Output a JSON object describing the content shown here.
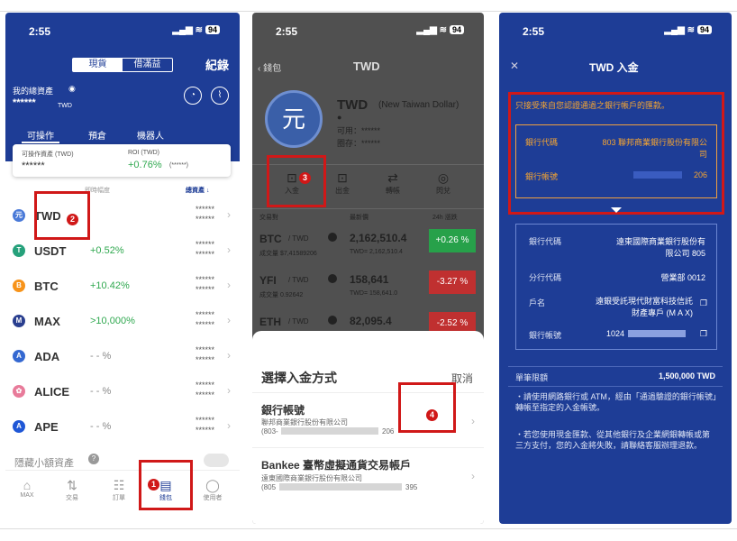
{
  "panel1": {
    "time": "2:55",
    "battery": "94",
    "seg": [
      "現貨",
      "借滿益"
    ],
    "record": "紀錄",
    "asset_label": "我的總資產",
    "asset_value": "******",
    "asset_unit": "TWD",
    "tabs": [
      "可操作",
      "預倉",
      "機器人"
    ],
    "op_label": "可操作資產 (TWD)",
    "op_value": "******",
    "roi_label": "ROI (TWD)",
    "roi_value": "+0.76%",
    "roi_sub": "(******)",
    "col_headers": [
      "",
      "即時幅度",
      "總資產 ↓"
    ],
    "coins": [
      {
        "sym": "TWD",
        "chg": "",
        "color": "#4a7ad8",
        "glyph": "元"
      },
      {
        "sym": "USDT",
        "chg": "+0.52%",
        "color": "#26a17b",
        "glyph": "T"
      },
      {
        "sym": "BTC",
        "chg": "+10.42%",
        "color": "#f7931a",
        "glyph": "B"
      },
      {
        "sym": "MAX",
        "chg": ">10,000%",
        "color": "#2a3f8f",
        "glyph": "M"
      },
      {
        "sym": "ADA",
        "chg": "- - %",
        "color": "#3468d1",
        "glyph": "A"
      },
      {
        "sym": "ALICE",
        "chg": "- - %",
        "color": "#e87b9a",
        "glyph": "✿"
      },
      {
        "sym": "APE",
        "chg": "- - %",
        "color": "#1f57d6",
        "glyph": "A"
      }
    ],
    "star1": "******",
    "star2": "******",
    "hide_small": "隱藏小額資產",
    "nav": [
      "MAX",
      "交易",
      "訂單",
      "錢包",
      "使用者"
    ],
    "badge_2": "2",
    "badge_1": "1"
  },
  "panel2": {
    "time": "2:55",
    "battery": "94",
    "back": "錢包",
    "title": "TWD",
    "coin_name": "TWD",
    "coin_full": "(New Taiwan Dollar)",
    "avail": "可用：******",
    "frozen": "圈存：******",
    "actions": [
      "入金",
      "出金",
      "轉帳",
      "閃兌"
    ],
    "badge_3": "3",
    "col_headers": [
      "交易對",
      "最新價",
      "24h 漲跌"
    ],
    "pairs": [
      {
        "pair": "BTC",
        "quote": "/ TWD",
        "vol": "成交量 $7,41589206",
        "price": "2,162,510.4",
        "twd": "TWD= 2,162,510.4",
        "chg": "+0.26 %",
        "color": "#27a14a"
      },
      {
        "pair": "YFI",
        "quote": "/ TWD",
        "vol": "成交量 0.92642",
        "price": "158,641",
        "twd": "TWD= 158,641.0",
        "chg": "-3.27 %",
        "color": "#c03030"
      },
      {
        "pair": "ETH",
        "quote": "/ TWD",
        "vol": "",
        "price": "82,095.4",
        "twd": "",
        "chg": "-2.52 %",
        "color": "#c03030"
      }
    ],
    "sheet_title": "選擇入金方式",
    "cancel": "取消",
    "opt1_title": "銀行帳號",
    "opt1_sub": "聯邦商業銀行股份有限公司",
    "opt1_acct": "(803-",
    "opt1_tail": "206",
    "opt2_title": "Bankee 臺幣虛擬通貨交易帳戶",
    "opt2_sub": "遠東國際商業銀行股份有限公司",
    "opt2_acct": "(805",
    "opt2_tail": "395",
    "badge_4": "4"
  },
  "panel3": {
    "time": "2:55",
    "battery": "94",
    "title": "TWD 入金",
    "warning": "只接受來自您認證通過之銀行帳戶的匯款。",
    "bank_code_label": "銀行代碼",
    "bank_code_value": "803 聯邦商業銀行股份有限公司",
    "acct_label": "銀行帳號",
    "acct_value": "206",
    "to_bank_label": "銀行代碼",
    "to_bank_value": "遠東國際商業銀行股份有限公司 805",
    "branch_label": "分行代碼",
    "branch_value": "營業部 0012",
    "name_label": "戶名",
    "name_value": "遠銀受託現代財富科技信託財產專戶 (M A X)",
    "to_acct_label": "銀行帳號",
    "to_acct_value": "1024",
    "limit_label": "單筆限額",
    "limit_value": "1,500,000 TWD",
    "note1": "・請使用網路銀行或 ATM，經由「通過驗證的銀行帳號」轉帳至指定的入金帳號。",
    "note2": "・若您使用現金匯款、從其他銀行及企業網銀轉帳或第三方支付，您的入金將失敗，請聯絡客服辦理退款。"
  }
}
